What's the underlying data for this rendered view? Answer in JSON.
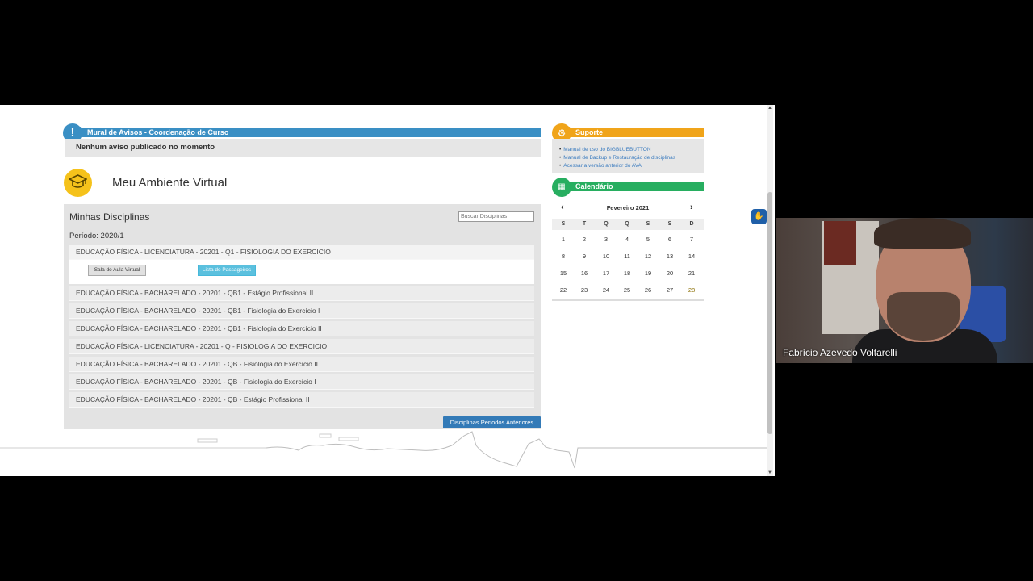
{
  "mural": {
    "title": "Mural de Avisos - Coordenação de Curso",
    "icon": "exclamation-icon",
    "message": "Nenhum aviso publicado no momento"
  },
  "ambiente": {
    "title": "Meu Ambiente Virtual",
    "icon": "graduation-cap-icon"
  },
  "disciplinas": {
    "title": "Minhas Disciplinas",
    "search_placeholder": "Buscar Disciplinas",
    "periodo": "Período: 2020/1",
    "rows": [
      "EDUCAÇÃO FÍSICA - LICENCIATURA - 20201 - Q1 - FISIOLOGIA DO EXERCICIO",
      "EDUCAÇÃO FÍSICA - BACHARELADO - 20201 - QB1 - Estágio Profissional II",
      "EDUCAÇÃO FÍSICA - BACHARELADO - 20201 - QB1 - Fisiologia do Exercício I",
      "EDUCAÇÃO FÍSICA - BACHARELADO - 20201 - QB1 - Fisiologia do Exercício II",
      "EDUCAÇÃO FÍSICA - LICENCIATURA - 20201 - Q - FISIOLOGIA DO EXERCICIO",
      "EDUCAÇÃO FÍSICA - BACHARELADO - 20201 - QB - Fisiologia do Exercício II",
      "EDUCAÇÃO FÍSICA - BACHARELADO - 20201 - QB - Fisiologia do Exercício I",
      "EDUCAÇÃO FÍSICA - BACHARELADO - 20201 - QB - Estágio Profissional II"
    ],
    "btn_sala": "Sala de Aula Virtual",
    "btn_lista": "Lista de Passageiros",
    "btn_anteriores": "Disciplinas Periodos Anteriores"
  },
  "suporte": {
    "title": "Suporte",
    "icon": "gears-icon",
    "links": [
      "Manual de uso do BIGBLUEBUTTON",
      "Manual de Backup e Restauração de disciplinas",
      "Acessar a versão anterior do AVA"
    ]
  },
  "calendario": {
    "title": "Calendário",
    "icon": "calendar-icon",
    "month": "Fevereiro 2021",
    "prev": "‹",
    "next": "›",
    "weekdays": [
      "S",
      "T",
      "Q",
      "Q",
      "S",
      "S",
      "D"
    ],
    "weeks": [
      [
        "1",
        "2",
        "3",
        "4",
        "5",
        "6",
        "7"
      ],
      [
        "8",
        "9",
        "10",
        "11",
        "12",
        "13",
        "14"
      ],
      [
        "15",
        "16",
        "17",
        "18",
        "19",
        "20",
        "21"
      ],
      [
        "22",
        "23",
        "24",
        "25",
        "26",
        "27",
        "28"
      ]
    ],
    "highlight_day": "28"
  },
  "webcam": {
    "participant_name": "Fabrício Azevedo Voltarelli"
  },
  "colors": {
    "mural": "#3a8fc4",
    "suporte": "#f0a41a",
    "calendario": "#27ae60",
    "ambiente": "#f5c21b",
    "primary_button": "#337ab7",
    "info_button": "#5bc0de"
  }
}
